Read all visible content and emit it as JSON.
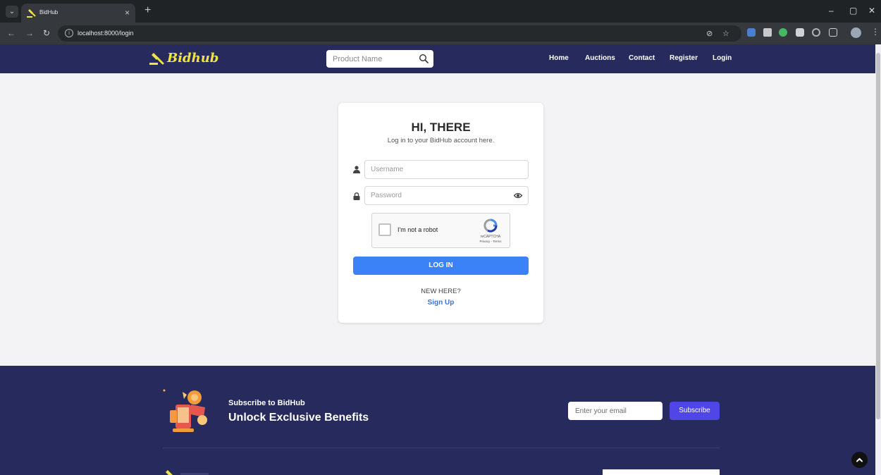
{
  "browser": {
    "tab_title": "BidHub",
    "url": "localhost:8000/login",
    "icons": [
      "tab-menu-icon",
      "close-icon",
      "plus-icon",
      "back-icon",
      "forward-icon",
      "reload-icon",
      "info-icon",
      "eye-off-icon",
      "star-icon",
      "extension-icons",
      "profile-icon",
      "kebab-icon",
      "minimize-icon",
      "restore-icon",
      "close-window-icon"
    ]
  },
  "header": {
    "logo_text": "Bidhub",
    "search_placeholder": "Product Name",
    "nav": [
      {
        "label": "Home"
      },
      {
        "label": "Auctions"
      },
      {
        "label": "Contact"
      },
      {
        "label": "Register"
      },
      {
        "label": "Login"
      }
    ],
    "colors": {
      "background": "#272a5d",
      "logo": "#f0e442"
    }
  },
  "login": {
    "title": "HI, THERE",
    "subtitle": "Log in to your BidHub account here.",
    "username_placeholder": "Username",
    "password_placeholder": "Password",
    "captcha_label": "I'm not a robot",
    "captcha_brand": "reCAPTCHA",
    "captcha_links": "Privacy - Terms",
    "login_button": "LOG IN",
    "new_here": "NEW HERE?",
    "signup_link": "Sign Up",
    "colors": {
      "primary": "#3b82f6",
      "link": "#3b72e8"
    }
  },
  "footer": {
    "subscribe_small": "Subscribe to BidHub",
    "subscribe_big": "Unlock Exclusive Benefits",
    "email_placeholder": "Enter your email",
    "subscribe_button": "Subscribe",
    "colors": {
      "background": "#272a5d",
      "button": "#4f46e5"
    }
  }
}
